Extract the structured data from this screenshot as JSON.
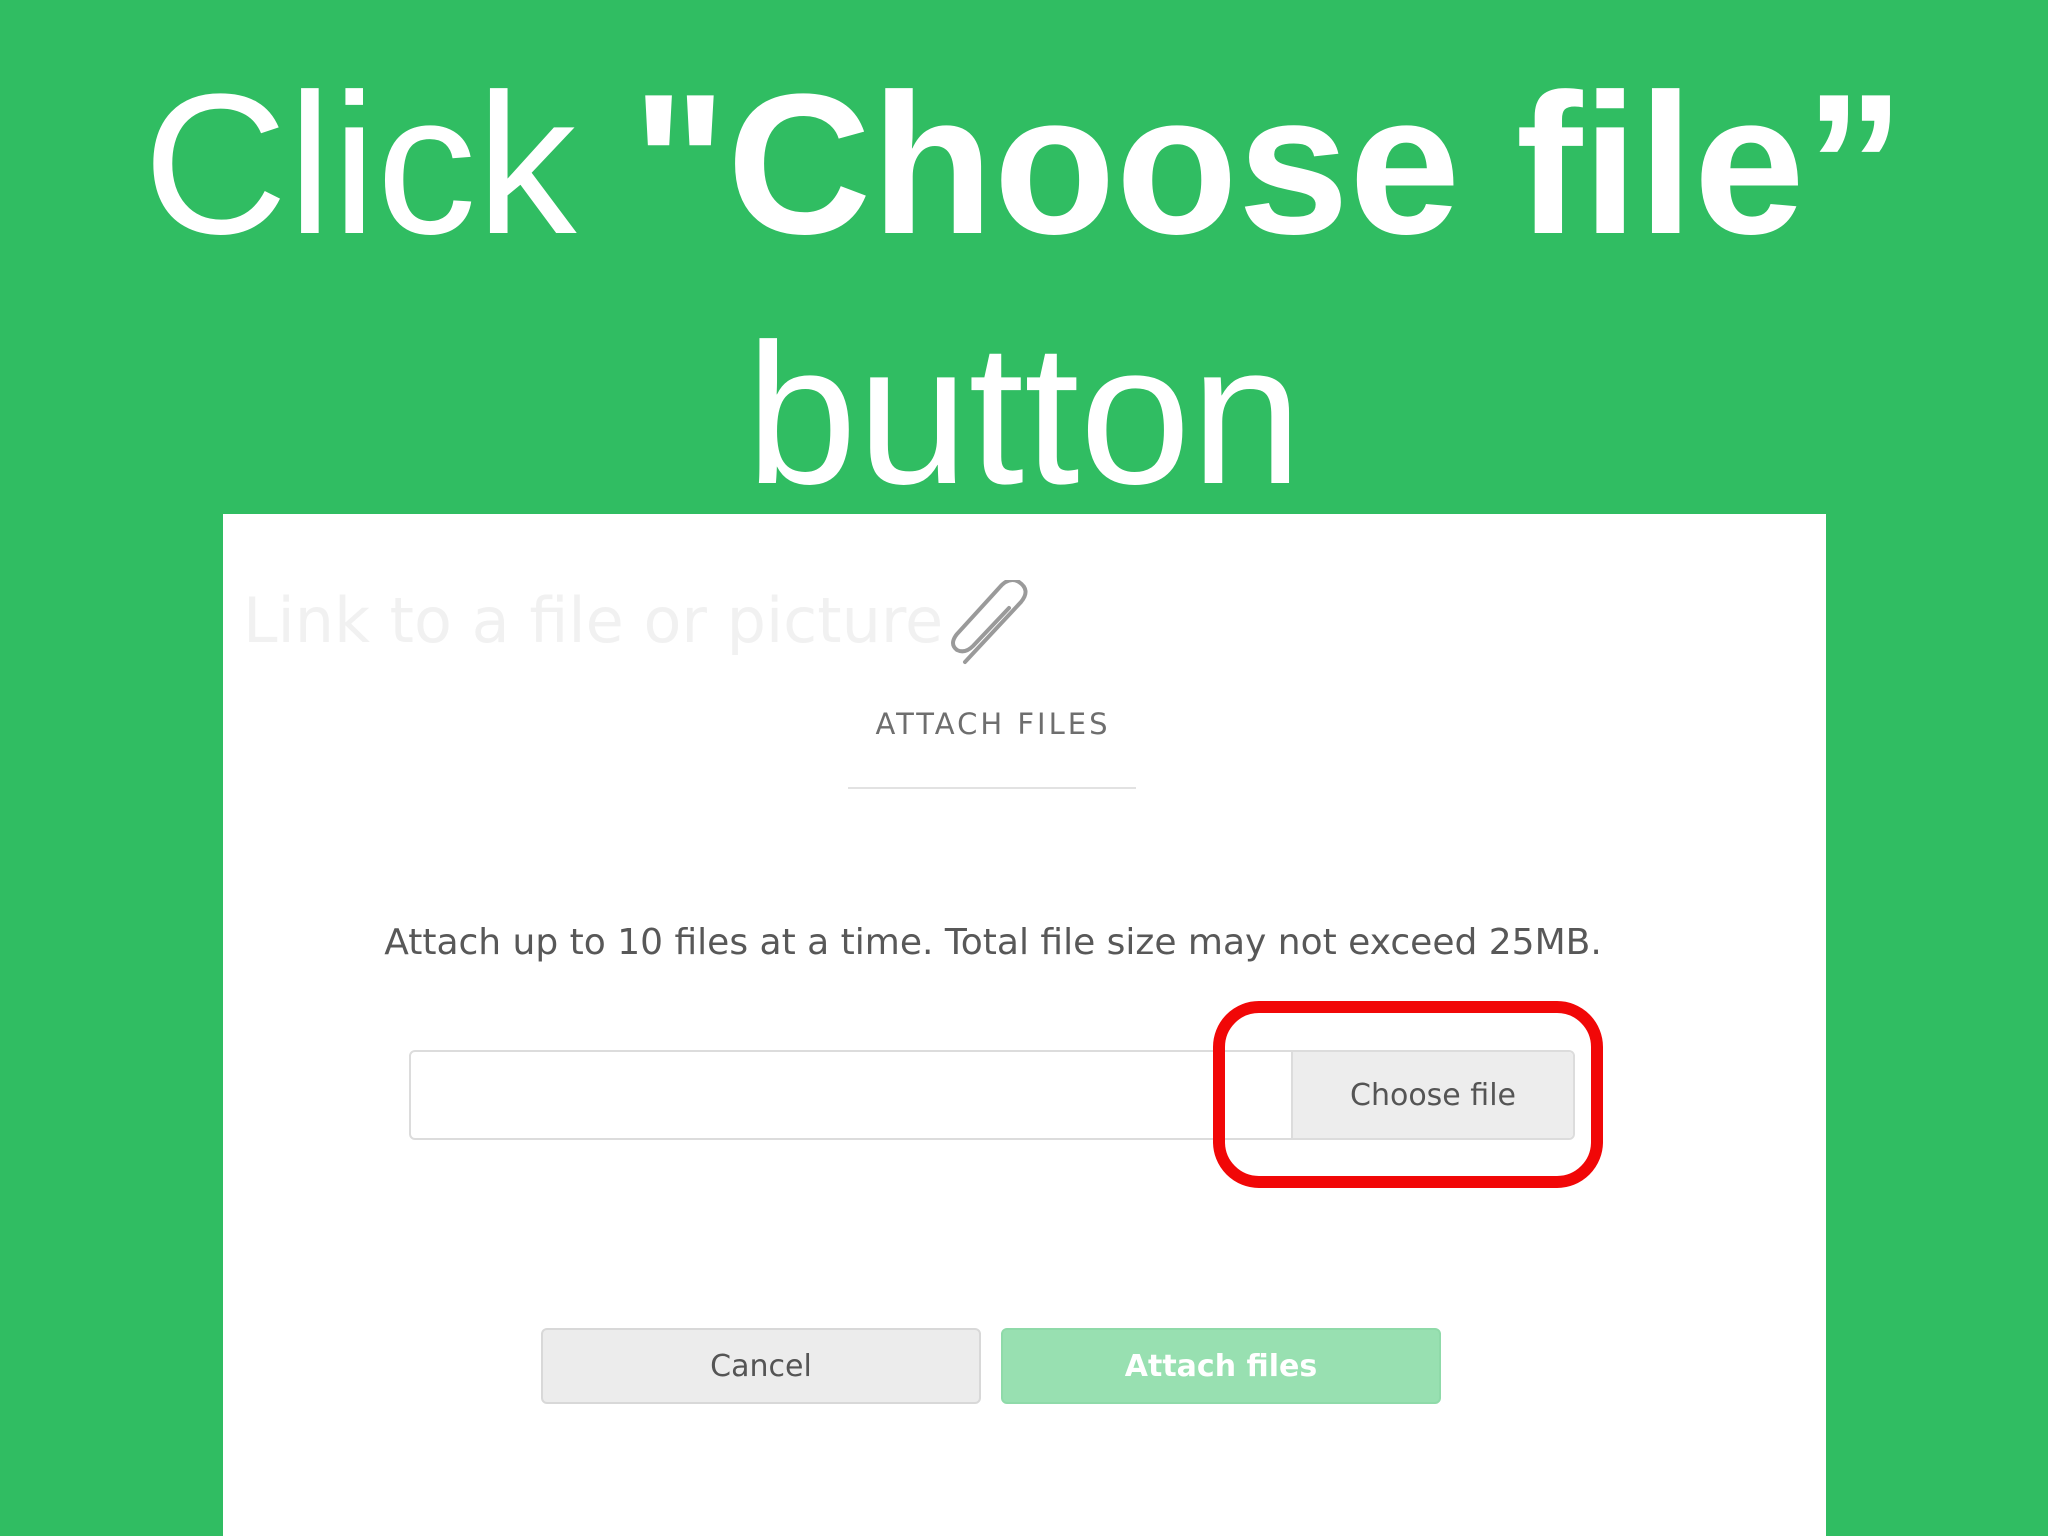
{
  "headline": {
    "line1_prefix": "Click ",
    "line1_bold": "\"Choose file”",
    "line2": "button"
  },
  "dialog": {
    "background_text": "Link to a file or picture",
    "icon": "paperclip-icon",
    "title": "ATTACH FILES",
    "info": "Attach up to 10 files at a time. Total file size may not exceed 25MB.",
    "file_input": {
      "value": "",
      "button_label": "Choose file"
    },
    "buttons": {
      "cancel": "Cancel",
      "attach": "Attach files"
    }
  },
  "colors": {
    "background": "#30bd62",
    "highlight": "#f10707",
    "attach_button": "#98e0b1"
  }
}
